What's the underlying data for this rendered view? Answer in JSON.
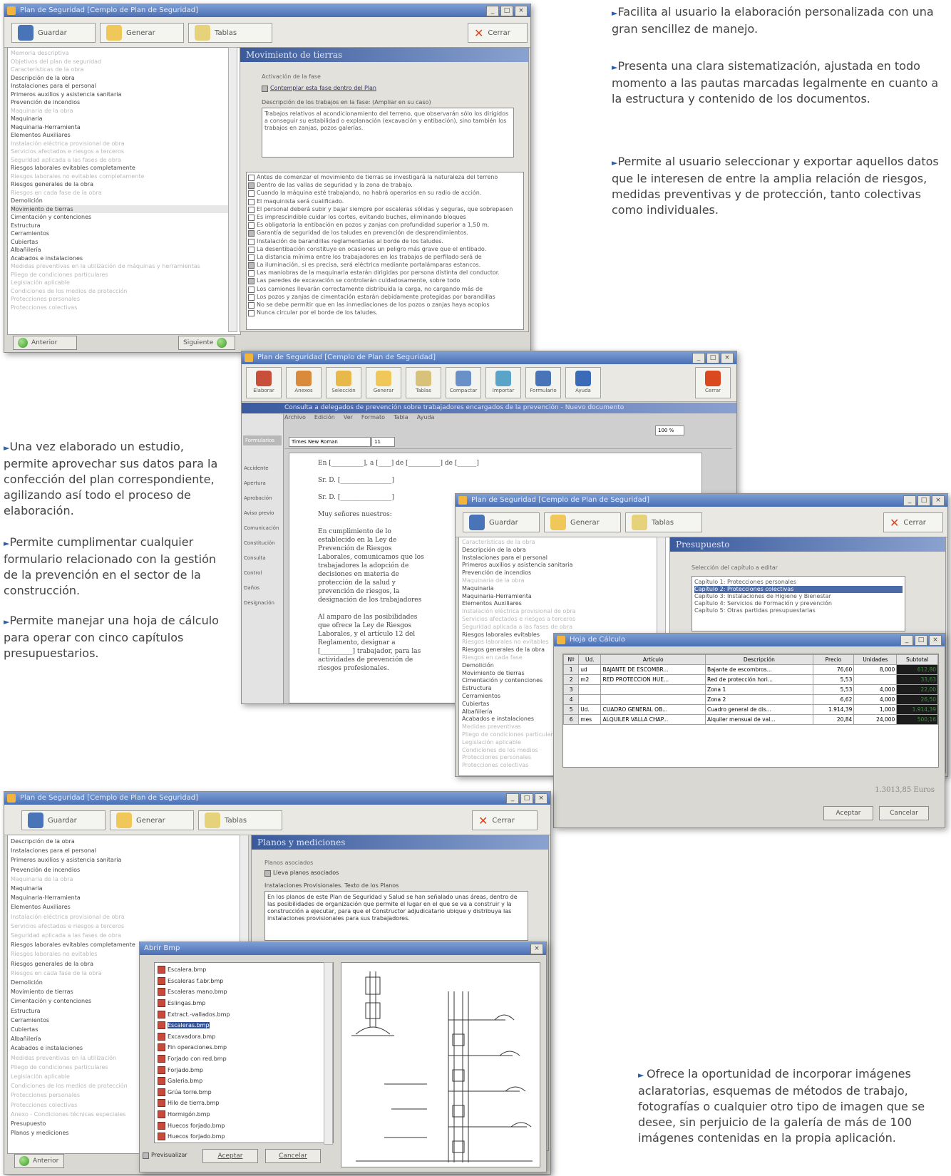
{
  "bullets_top": [
    "Facilita al usuario la elaboración personalizada con una gran sencillez de manejo.",
    "Presenta una clara sistematización, ajustada en todo momento a las pautas marcadas legalmente en cuanto a la estructura y contenido de los documentos.",
    "Permite al usuario seleccionar y exportar aquellos datos que le interesen de entre la  amplia relación de riesgos, medidas preventivas y de protección, tanto colectivas como individuales."
  ],
  "bullets_left": [
    "Una vez elaborado un estudio, permite aprovechar sus datos para la confección del plan correspondiente, agilizando así todo el proceso de elaboración.",
    "Permite cumplimentar cualquier formulario relacionado con la gestión de la prevención en el sector de la construcción.",
    "Permite manejar una hoja de cálculo para operar con cinco capítulos presupuestarios."
  ],
  "bullet_bottom": "Ofrece la oportunidad de incorporar imágenes aclaratorias, esquemas de métodos de trabajo, fotografías o cualquier otro tipo de imagen que se desee, sin perjuicio de la galería de más de 100 imágenes contenidas en la propia aplicación.",
  "win1": {
    "title": "Plan de Seguridad [Cemplo de Plan de Seguridad]",
    "toolbar": {
      "save": "Guardar",
      "generate": "Generar",
      "tables": "Tablas",
      "close": "Cerrar"
    },
    "tree": [
      {
        "text": "Memoria descriptiva",
        "dim": true
      },
      {
        "text": "Objetivos del plan de seguridad",
        "dim": true
      },
      {
        "text": "Características de la obra",
        "dim": true
      },
      {
        "text": "Descripción de la obra",
        "dim": false
      },
      {
        "text": "Instalaciones para el personal",
        "dim": false
      },
      {
        "text": "Primeros auxilios y asistencia sanitaria",
        "dim": false
      },
      {
        "text": "Prevención de incendios",
        "dim": false
      },
      {
        "text": "Maquinaria de la obra",
        "dim": true
      },
      {
        "text": "Maquinaria",
        "dim": false
      },
      {
        "text": "Maquinaria-Herramienta",
        "dim": false
      },
      {
        "text": "Elementos Auxiliares",
        "dim": false
      },
      {
        "text": "Instalación eléctrica provisional de obra",
        "dim": true
      },
      {
        "text": "Servicios afectados e riesgos a terceros",
        "dim": true
      },
      {
        "text": "Seguridad aplicada a las fases de obra",
        "dim": true
      },
      {
        "text": "Riesgos laborales evitables completamente",
        "dim": false
      },
      {
        "text": "Riesgos laborales no evitables completamente",
        "dim": true
      },
      {
        "text": "Riesgos generales de la obra",
        "dim": false
      },
      {
        "text": "Riesgos en cada fase de la obra",
        "dim": true
      },
      {
        "text": "Demolición",
        "dim": false
      },
      {
        "text": "Movimiento de tierras",
        "dim": false
      },
      {
        "text": "Cimentación y contenciones",
        "dim": false
      },
      {
        "text": "Estructura",
        "dim": false
      },
      {
        "text": "Cerramientos",
        "dim": false
      },
      {
        "text": "Cubiertas",
        "dim": false
      },
      {
        "text": "Albañilería",
        "dim": false
      },
      {
        "text": "Acabados e instalaciones",
        "dim": false
      },
      {
        "text": "Medidas preventivas en la utilización de máquinas y herramientas",
        "dim": true
      },
      {
        "text": "Pliego de condiciones particulares",
        "dim": true
      },
      {
        "text": "Legislación aplicable",
        "dim": true
      },
      {
        "text": "Condiciones de los medios de protección",
        "dim": true
      },
      {
        "text": "Protecciones personales",
        "dim": true
      },
      {
        "text": "Protecciones colectivas",
        "dim": true
      }
    ],
    "panel_title": "Movimiento de tierras",
    "group_label": "Activación de la fase",
    "check_label": "Contemplar esta fase dentro del Plan",
    "desc_label": "Descripción de los trabajos en la fase: (Ampliar en su caso)",
    "desc_text": "Trabajos relativos al acondicionamiento del terreno, que observarán sólo los dirigidos a conseguir su estabilidad o explanación (excavación y entibación), sino también los trabajos en zanjas, pozos galerías.",
    "measures": [
      {
        "text": "Antes de comenzar el movimiento de tierras se investigará la naturaleza del terreno",
        "on": false
      },
      {
        "text": "Dentro de las vallas de seguridad y la zona de trabajo.",
        "on": true
      },
      {
        "text": "Cuando la máquina esté trabajando, no habrá operarios en su radio de acción.",
        "on": false
      },
      {
        "text": "El maquinista será cualificado.",
        "on": false
      },
      {
        "text": "El personal deberá subir y bajar siempre por escaleras sólidas y seguras, que sobrepasen",
        "on": false
      },
      {
        "text": "Es imprescindible cuidar los cortes, evitando buches, eliminando bloques",
        "on": false
      },
      {
        "text": "Es obligatoria la entibación en pozos y zanjas con profundidad superior a 1,50 m.",
        "on": false
      },
      {
        "text": "Garantía de seguridad de los taludes en prevención de desprendimientos.",
        "on": true
      },
      {
        "text": "Instalación de barandillas reglamentarias al borde de los taludes.",
        "on": false
      },
      {
        "text": "La desentibación constituye en ocasiones un peligro más grave que el entibado.",
        "on": false
      },
      {
        "text": "La distancia mínima entre los trabajadores en los trabajos de perfilado será de",
        "on": false
      },
      {
        "text": "La iluminación, si es precisa, será eléctrica mediante portalámparas estancos.",
        "on": true
      },
      {
        "text": "Las maniobras de la maquinaria estarán dirigidas por persona distinta del conductor.",
        "on": false
      },
      {
        "text": "Las paredes de excavación se controlarán cuidadosamente, sobre todo",
        "on": true
      },
      {
        "text": "Los camiones llevarán correctamente distribuida la carga, no cargando más de",
        "on": false
      },
      {
        "text": "Los pozos y zanjas de cimentación estarán debidamente protegidas por barandillas",
        "on": false
      },
      {
        "text": "No se debe permitir que en las inmediaciones de los pozos o zanjas haya acopios",
        "on": false
      },
      {
        "text": "Nunca circular por el borde de los taludes.",
        "on": false
      }
    ],
    "btn_prev": "Anterior",
    "btn_next": "Siguiente"
  },
  "win2": {
    "title": "Plan de Seguridad [Cemplo de Plan de Seguridad]",
    "toolbar": [
      "Elaborar",
      "Anexos",
      "Selección",
      "Generar",
      "Tablas",
      "Compactar",
      "Importar",
      "Formulario",
      "Ayuda",
      "Cerrar"
    ],
    "doc_title": "Consulta a delegados de prevención sobre trabajadores encargados de la prevención - Nuevo documento",
    "menu": [
      "Archivo",
      "Edición",
      "Ver",
      "Formato",
      "Tabla",
      "Ayuda"
    ],
    "font_name": "Times New Roman",
    "font_size": "11",
    "zoom": "100 %",
    "left_tab": "Formularios",
    "list_items": [
      "Accidente",
      "Apertura",
      "Aprobación",
      "Aviso previo",
      "Comunicación",
      "Constitución",
      "Consulta",
      "Control",
      "Daños",
      "Designación"
    ],
    "doc_lines": [
      "En [__________], a [____] de [__________] de [______]",
      "Sr. D. [________________]",
      "Sr. D. [________________]",
      "Muy señores nuestros:",
      "En cumplimiento de lo establecido en la Ley de Prevención de Riesgos Laborales, comunicamos que los trabajadores la adopción de decisiones en materia de protección de la salud y prevención de riesgos, la designación de los trabajadores",
      "Al amparo de las posibilidades que ofrece la Ley de Riesgos Laborales, y el artículo 12 del Reglamento, designar a [__________] trabajador, para las actividades de prevención de riesgos profesionales."
    ]
  },
  "win3": {
    "title": "Plan de Seguridad [Cemplo de Plan de Seguridad]",
    "toolbar": {
      "save": "Guardar",
      "generate": "Generar",
      "tables": "Tablas",
      "close": "Cerrar"
    },
    "panel_title": "Presupuesto",
    "group_label": "Selección del capítulo a editar",
    "chapters": [
      "Capítulo 1: Protecciones personales",
      "Capítulo 2: Protecciones colectivas",
      "Capítulo 3: Instalaciones de Higiene y Bienestar",
      "Capítulo 4: Servicios de Formación y prevención",
      "Capítulo 5: Otras partidas presupuestarias"
    ],
    "tree": [
      "Características de la obra",
      "Descripción de la obra",
      "Instalaciones para el personal",
      "Primeros auxilios y asistencia sanitaria",
      "Prevención de incendios",
      "Maquinaria de la obra",
      "Maquinaria",
      "Maquinaria-Herramienta",
      "Elementos Auxiliares",
      "Instalación eléctrica provisional de obra",
      "Servicios afectados e riesgos a terceros",
      "Seguridad aplicada a las fases de obra",
      "Riesgos laborales evitables",
      "Riesgos laborales no evitables",
      "Riesgos generales de la obra",
      "Riesgos en cada fase",
      "Demolición",
      "Movimiento de tierras",
      "Cimentación y contenciones",
      "Estructura",
      "Cerramientos",
      "Cubiertas",
      "Albañilería",
      "Acabados e instalaciones",
      "Medidas preventivas",
      "Pliego de condiciones particulares",
      "Legislación aplicable",
      "Condiciones de los medios",
      "Protecciones personales",
      "Protecciones colectivas"
    ]
  },
  "calc": {
    "title": "Hoja de Cálculo",
    "headers": [
      "Nº",
      "Ud.",
      "Artículo",
      "Descripción",
      "Precio",
      "Unidades",
      "Subtotal"
    ],
    "rows": [
      [
        "1",
        "ud",
        "BAJANTE DE ESCOMBR...",
        "Bajante de escombros...",
        "76,60",
        "8,000",
        "612,80"
      ],
      [
        "2",
        "m2",
        "RED PROTECCION HUE...",
        "Red de protección hori...",
        "5,53",
        "",
        "33,63"
      ],
      [
        "3",
        "",
        "",
        "Zona 1",
        "5,53",
        "4,000",
        "22,00"
      ],
      [
        "4",
        "",
        "",
        "Zona 2",
        "6,62",
        "4,000",
        "26,50"
      ],
      [
        "5",
        "Ud.",
        "CUADRO GENERAL OB...",
        "Cuadro general de dis...",
        "1.914,39",
        "1,000",
        "1.914,39"
      ],
      [
        "6",
        "mes",
        "ALQUILER VALLA CHAP...",
        "Alquiler mensual de val...",
        "20,84",
        "24,000",
        "500,16"
      ]
    ],
    "total": "1.3013,85 Euros",
    "btn_ok": "Aceptar",
    "btn_cancel": "Cancelar"
  },
  "win4": {
    "title": "Plan de Seguridad [Cemplo de Plan de Seguridad]",
    "toolbar": {
      "save": "Guardar",
      "generate": "Generar",
      "tables": "Tablas",
      "close": "Cerrar"
    },
    "panel_title": "Planos y mediciones",
    "group_label": "Planos asociados",
    "check_label": "Lleva planos asociados",
    "sub_label": "Instalaciones Provisionales. Texto de los Planos",
    "desc_text": "En los planos de este Plan de Seguridad y Salud se han señalado unas áreas, dentro de las posibilidades de organización que permite el lugar en el que se va a construir y la construcción a ejecutar, para que el Constructor adjudicatario ubique y distribuya las instalaciones provisionales para sus trabajadores.",
    "tree": [
      {
        "text": "Descripción de la obra",
        "dim": false
      },
      {
        "text": "Instalaciones para el personal",
        "dim": false
      },
      {
        "text": "Primeros auxilios y asistencia sanitaria",
        "dim": false
      },
      {
        "text": "Prevención de incendios",
        "dim": false
      },
      {
        "text": "Maquinaria de la obra",
        "dim": true
      },
      {
        "text": "Maquinaria",
        "dim": false
      },
      {
        "text": "Maquinaria-Herramienta",
        "dim": false
      },
      {
        "text": "Elementos Auxiliares",
        "dim": false
      },
      {
        "text": "Instalación eléctrica provisional de obra",
        "dim": true
      },
      {
        "text": "Servicios afectados e riesgos a terceros",
        "dim": true
      },
      {
        "text": "Seguridad aplicada a las fases de obra",
        "dim": true
      },
      {
        "text": "Riesgos laborales evitables completamente",
        "dim": false
      },
      {
        "text": "Riesgos laborales no evitables",
        "dim": true
      },
      {
        "text": "Riesgos generales de la obra",
        "dim": false
      },
      {
        "text": "Riesgos en cada fase de la obra",
        "dim": true
      },
      {
        "text": "Demolición",
        "dim": false
      },
      {
        "text": "Movimiento de tierras",
        "dim": false
      },
      {
        "text": "Cimentación y contenciones",
        "dim": false
      },
      {
        "text": "Estructura",
        "dim": false
      },
      {
        "text": "Cerramientos",
        "dim": false
      },
      {
        "text": "Cubiertas",
        "dim": false
      },
      {
        "text": "Albañilería",
        "dim": false
      },
      {
        "text": "Acabados e instalaciones",
        "dim": false
      },
      {
        "text": "Medidas preventivas en la utilización",
        "dim": true
      },
      {
        "text": "Pliego de condiciones particulares",
        "dim": true
      },
      {
        "text": "Legislación aplicable",
        "dim": true
      },
      {
        "text": "Condiciones de los medios de protección",
        "dim": true
      },
      {
        "text": "Protecciones personales",
        "dim": true
      },
      {
        "text": "Protecciones colectivas",
        "dim": true
      },
      {
        "text": "Anexo - Condiciones técnicas especiales",
        "dim": true
      },
      {
        "text": "Presupuesto",
        "dim": false
      },
      {
        "text": "Planos y mediciones",
        "dim": false
      }
    ],
    "btn_prev": "Anterior"
  },
  "open_dialog": {
    "title": "Abrir Bmp",
    "files": [
      "Escalera.bmp",
      "Escaleras f.abr.bmp",
      "Escaleras mano.bmp",
      "Eslingas.bmp",
      "Extract.-vallados.bmp",
      "Escaleras.bmp",
      "Excavadora.bmp",
      "Fin operaciones.bmp",
      "Forjado con red.bmp",
      "Forjado.bmp",
      "Galeria.bmp",
      "Grúa torre.bmp",
      "Hilo de tierra.bmp",
      "Hormigón.bmp",
      "Huecos forjado.bmp",
      "Huecos forjado.bmp"
    ],
    "selected_index": 5,
    "preview_label": "Previsualizar",
    "ok": "Aceptar",
    "cancel": "Cancelar"
  }
}
